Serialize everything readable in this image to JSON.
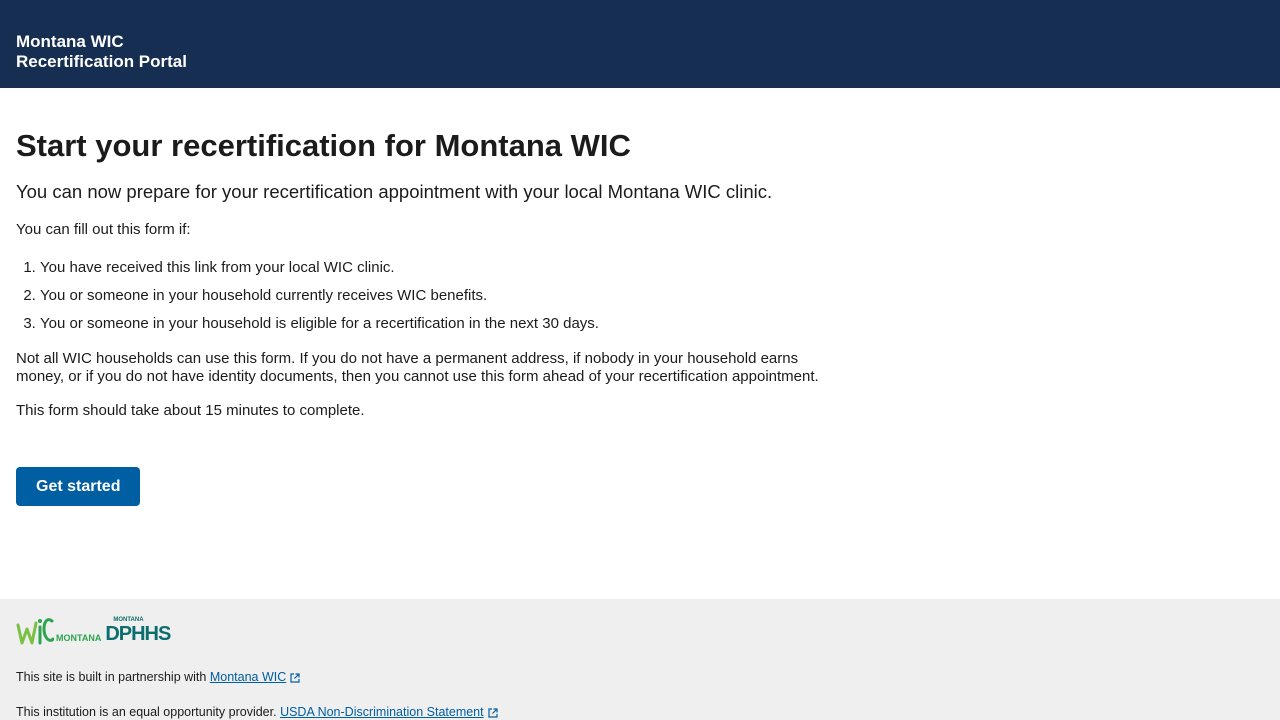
{
  "header": {
    "line1": "Montana WIC",
    "line2": "Recertification Portal"
  },
  "main": {
    "title": "Start your recertification for Montana WIC",
    "lead": "You can now prepare for your recertification appointment with your local Montana WIC clinic.",
    "intro": "You can fill out this form if:",
    "requirements": [
      "You have received this link from your local WIC clinic.",
      "You or someone in your household currently receives WIC benefits.",
      "You or someone in your household is eligible for a recertification in the next 30 days."
    ],
    "notice": "Not all WIC households can use this form. If you do not have a permanent address, if nobody in your household earns money, or if you do not have identity documents, then you cannot use this form ahead of your recertification appointment.",
    "duration": "This form should take about 15 minutes to complete.",
    "cta_label": "Get started"
  },
  "footer": {
    "logo_wic_small": "MONTANA",
    "logo_dphhs_small": "MONTANA",
    "logo_dphhs_big": "DPHHS",
    "partnership_text": "This site is built in partnership with",
    "partnership_link": "Montana WIC",
    "equal_text": "This institution is an equal opportunity provider.",
    "equal_link": "USDA Non-Discrimination Statement"
  },
  "colors": {
    "header_bg": "#162e51",
    "button_bg": "#005ea2",
    "footer_bg": "#efefef",
    "link": "#005ea2"
  }
}
